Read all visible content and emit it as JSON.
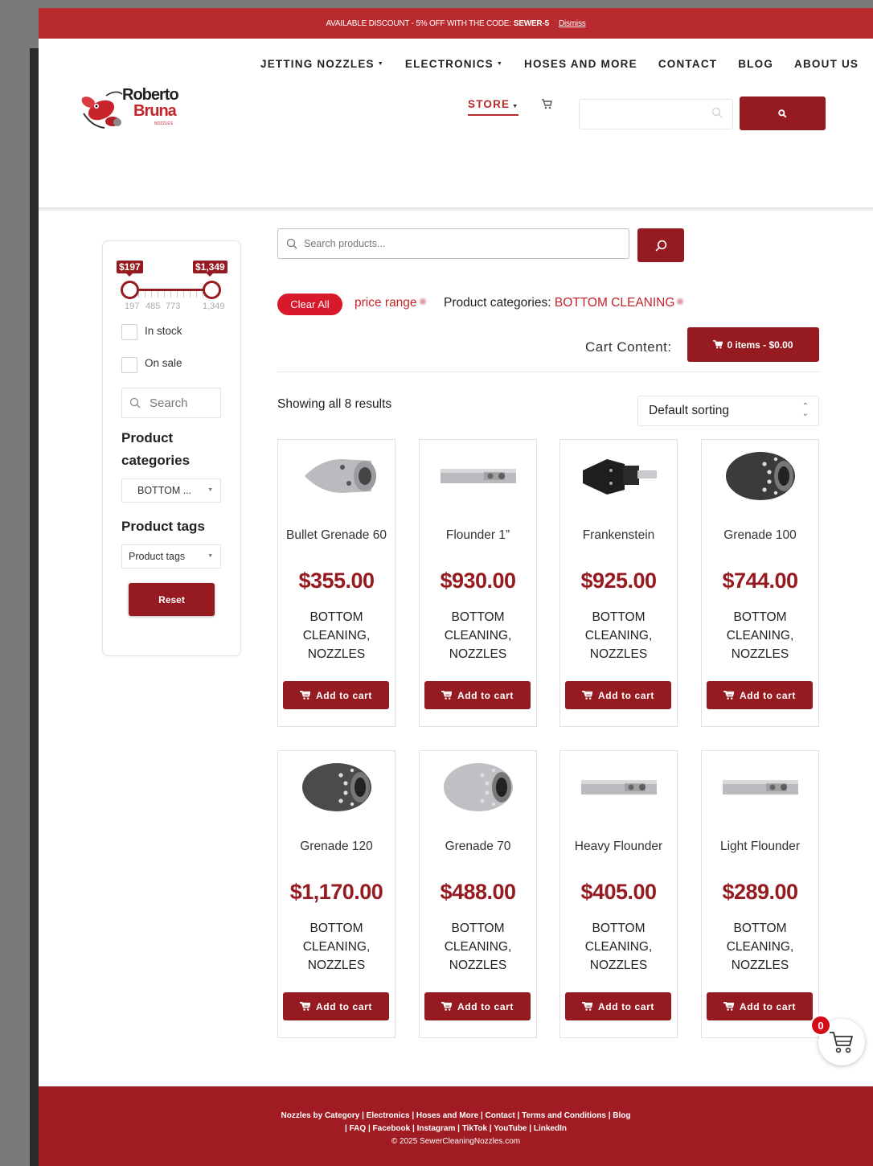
{
  "notice": {
    "text": "AVAILABLE DISCOUNT - 5% OFF WITH THE CODE:",
    "code": "SEWER-5",
    "dismiss": "Dismiss"
  },
  "brand": {
    "line1": "Roberto",
    "line2": "Bruna",
    "line3": "NOZZLES"
  },
  "nav": {
    "items": [
      "JETTING NOZZLES",
      "ELECTRONICS",
      "HOSES AND MORE",
      "CONTACT",
      "BLOG",
      "ABOUT US"
    ],
    "store": "STORE"
  },
  "filter": {
    "price_min_label": "$197",
    "price_max_label": "$1,349",
    "scale": [
      "197",
      "485",
      "773",
      "1,349"
    ],
    "in_stock": "In stock",
    "on_sale": "On sale",
    "search_placeholder": "Search",
    "categories_heading": "Product categories",
    "categories_value": "BOTTOM ...",
    "tags_heading": "Product tags",
    "tags_value": "Product tags",
    "reset": "Reset"
  },
  "main": {
    "search_placeholder": "Search products...",
    "clear_all": "Clear All",
    "chip_price": "price range",
    "chip_cat_label": "Product categories:",
    "chip_cat_value": "BOTTOM CLEANING",
    "cart_label": "Cart Content:",
    "cart_button": "0 items - $0.00",
    "results": "Showing all 8 results",
    "sort": "Default sorting",
    "add_to_cart": "Add to cart"
  },
  "products": [
    {
      "name": "Bullet Grenade 60",
      "price": "$355.00",
      "cats": [
        "BOTTOM",
        "CLEANING,",
        "NOZZLES"
      ],
      "shape": "bullet",
      "color": "#b9bbbf"
    },
    {
      "name": "Flounder 1”",
      "price": "$930.00",
      "cats": [
        "BOTTOM",
        "CLEANING,",
        "NOZZLES"
      ],
      "shape": "flat",
      "color": "#b9bbbf"
    },
    {
      "name": "Frankenstein",
      "price": "$925.00",
      "cats": [
        "BOTTOM",
        "CLEANING,",
        "NOZZLES"
      ],
      "shape": "franken",
      "color": "#1e1e1e"
    },
    {
      "name": "Grenade 100",
      "price": "$744.00",
      "cats": [
        "BOTTOM",
        "CLEANING,",
        "NOZZLES"
      ],
      "shape": "grenade",
      "color": "#3a3b3d"
    },
    {
      "name": "Grenade 120",
      "price": "$1,170.00",
      "cats": [
        "BOTTOM",
        "CLEANING,",
        "NOZZLES"
      ],
      "shape": "grenade",
      "color": "#4a4b4d"
    },
    {
      "name": "Grenade 70",
      "price": "$488.00",
      "cats": [
        "BOTTOM",
        "CLEANING,",
        "NOZZLES"
      ],
      "shape": "grenade",
      "color": "#bfc0c3"
    },
    {
      "name": "Heavy Flounder",
      "price": "$405.00",
      "cats": [
        "BOTTOM",
        "CLEANING,",
        "NOZZLES"
      ],
      "shape": "flat",
      "color": "#b9bbbf"
    },
    {
      "name": "Light Flounder",
      "price": "$289.00",
      "cats": [
        "BOTTOM",
        "CLEANING,",
        "NOZZLES"
      ],
      "shape": "flat",
      "color": "#b9bbbf"
    }
  ],
  "float_cart": {
    "count": "0"
  },
  "footer": {
    "line1": "Nozzles by Category | Electronics | Hoses and More | Contact | Terms and Conditions | Blog",
    "line2": "| FAQ | Facebook | Instagram | TikTok | YouTube | LinkedIn",
    "line3": "© 2025 SewerCleaningNozzles.com"
  },
  "colors": {
    "brand_red": "#961b21",
    "notice_red": "#b92a2f",
    "accent_red": "#d8182b"
  }
}
